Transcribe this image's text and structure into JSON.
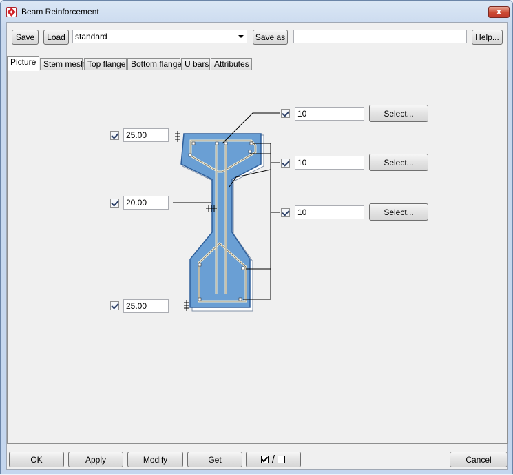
{
  "window": {
    "title": "Beam Reinforcement",
    "close_glyph": "x"
  },
  "toolbar": {
    "save_label": "Save",
    "load_label": "Load",
    "preset_value": "standard",
    "save_as_label": "Save as",
    "save_as_value": "",
    "help_label": "Help..."
  },
  "tabs": [
    {
      "label": "Picture",
      "active": true
    },
    {
      "label": "Stem mesh"
    },
    {
      "label": "Top flange"
    },
    {
      "label": "Bottom flange"
    },
    {
      "label": "U bars"
    },
    {
      "label": "Attributes"
    }
  ],
  "picture": {
    "top_cover": {
      "checked": true,
      "value": "25.00"
    },
    "side_cover": {
      "checked": true,
      "value": "20.00"
    },
    "bottom_cover": {
      "checked": true,
      "value": "25.00"
    },
    "bar_top": {
      "checked": true,
      "value": "10",
      "select_label": "Select..."
    },
    "bar_middle": {
      "checked": true,
      "value": "10",
      "select_label": "Select..."
    },
    "bar_bottom": {
      "checked": true,
      "value": "10",
      "select_label": "Select..."
    }
  },
  "colors": {
    "concrete": "#6a9fd4",
    "concrete_edge": "#2f5f9a",
    "rebar": "#f3ecd2"
  },
  "bottom_bar": {
    "ok_label": "OK",
    "apply_label": "Apply",
    "modify_label": "Modify",
    "get_label": "Get",
    "toggle_separator": "/",
    "cancel_label": "Cancel"
  }
}
